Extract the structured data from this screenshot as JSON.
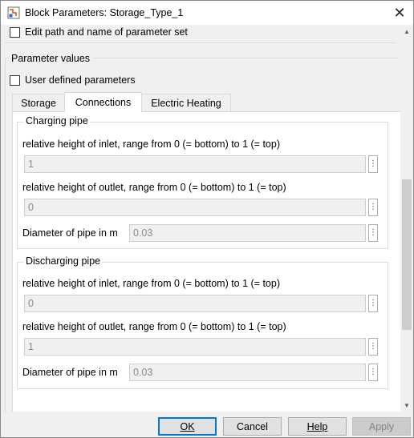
{
  "window": {
    "title": "Block Parameters: Storage_Type_1",
    "close_glyph": "✕"
  },
  "edit_path": {
    "label": "Edit path and name of parameter set",
    "checked": false
  },
  "parameter_values": {
    "group_title": "Parameter values",
    "user_defined_label": "User defined parameters",
    "user_defined_checked": false,
    "tabs": [
      {
        "label": "Storage",
        "active": false
      },
      {
        "label": "Connections",
        "active": true
      },
      {
        "label": "Electric Heating",
        "active": false
      }
    ]
  },
  "charging_pipe": {
    "title": "Charging pipe",
    "inlet_label": "relative height of inlet, range from 0 (= bottom) to 1 (= top)",
    "inlet_value": "1",
    "outlet_label": "relative height of outlet, range from 0 (= bottom) to 1 (= top)",
    "outlet_value": "0",
    "diameter_label": "Diameter of pipe in m",
    "diameter_value": "0.03"
  },
  "discharging_pipe": {
    "title": "Discharging pipe",
    "inlet_label": "relative height of inlet, range from 0 (= bottom) to 1 (= top)",
    "inlet_value": "0",
    "outlet_label": "relative height of outlet, range from 0 (= bottom) to 1 (= top)",
    "outlet_value": "1",
    "diameter_label": "Diameter of pipe in m",
    "diameter_value": "0.03"
  },
  "buttons": {
    "ok": "OK",
    "cancel": "Cancel",
    "help": "Help",
    "apply": "Apply"
  },
  "icons": {
    "app": "simulink-block-icon",
    "field_menu": "vertical-dots-icon"
  }
}
